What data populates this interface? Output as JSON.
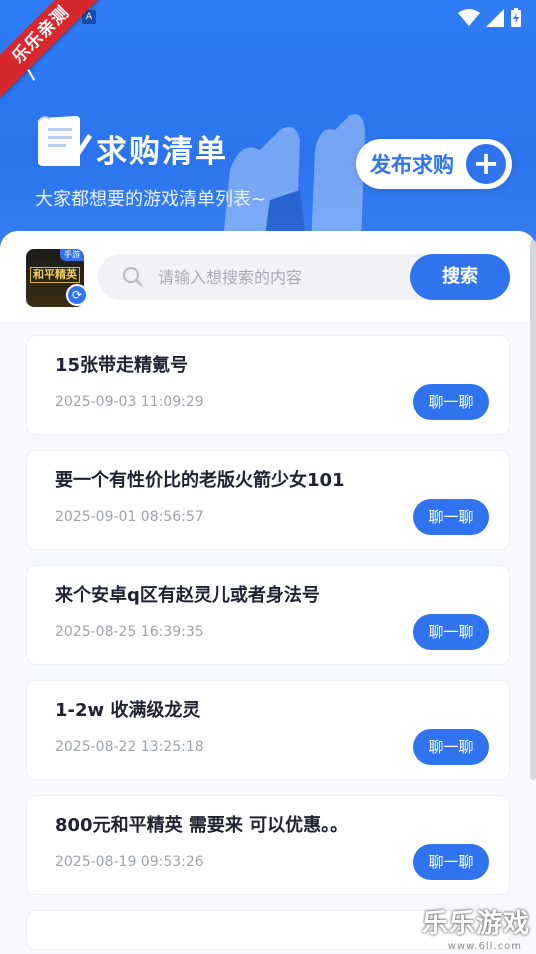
{
  "header": {
    "title": "求购清单",
    "subtitle": "大家都想要的游戏清单列表~",
    "publish_label": "发布求购",
    "publish_plus": "+"
  },
  "ribbon": {
    "text": "乐乐亲测"
  },
  "game": {
    "name": "和平精英",
    "tag": "手游"
  },
  "search": {
    "placeholder": "请输入想搜索的内容",
    "button_label": "搜索"
  },
  "listings": [
    {
      "title": "15张带走精氪号",
      "time": "2025-09-03 11:09:29",
      "action": "聊一聊"
    },
    {
      "title": "要一个有性价比的老版火箭少女101",
      "time": "2025-09-01 08:56:57",
      "action": "聊一聊"
    },
    {
      "title": "来个安卓q区有赵灵儿或者身法号",
      "time": "2025-08-25 16:39:35",
      "action": "聊一聊"
    },
    {
      "title": "1-2w 收满级龙灵",
      "time": "2025-08-22 13:25:18",
      "action": "聊一聊"
    },
    {
      "title": "800元和平精英 需要来 可以优惠。。",
      "time": "2025-08-19 09:53:26",
      "action": "聊一聊"
    }
  ],
  "watermark": {
    "text": "乐乐游戏",
    "url": "www.6ll.com"
  },
  "colors": {
    "accent": "#2f74ee",
    "ribbon": "#d8272d"
  }
}
